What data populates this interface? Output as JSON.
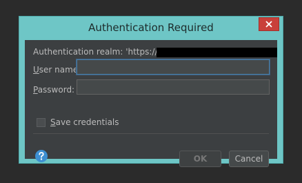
{
  "window": {
    "title": "Authentication Required",
    "close_icon": "close-icon"
  },
  "realm": {
    "text": "Authentication realm: 'https://svn."
  },
  "fields": {
    "username_label_mnemonic": "U",
    "username_label_rest": "ser name:",
    "username_value": "",
    "password_label_mnemonic": "P",
    "password_label_rest": "assword:",
    "password_value": ""
  },
  "save_credentials": {
    "label_mnemonic": "S",
    "label_rest": "ave credentials",
    "checked": false
  },
  "buttons": {
    "ok_label": "OK",
    "cancel_label": "Cancel"
  },
  "icons": {
    "help": "help-icon"
  },
  "colors": {
    "title_bar": "#6ec6c6",
    "dialog_body": "#3c3f41",
    "close_button": "#c9403a",
    "focus_border": "#4a7ea5",
    "help_icon": "#3d8fd1"
  }
}
